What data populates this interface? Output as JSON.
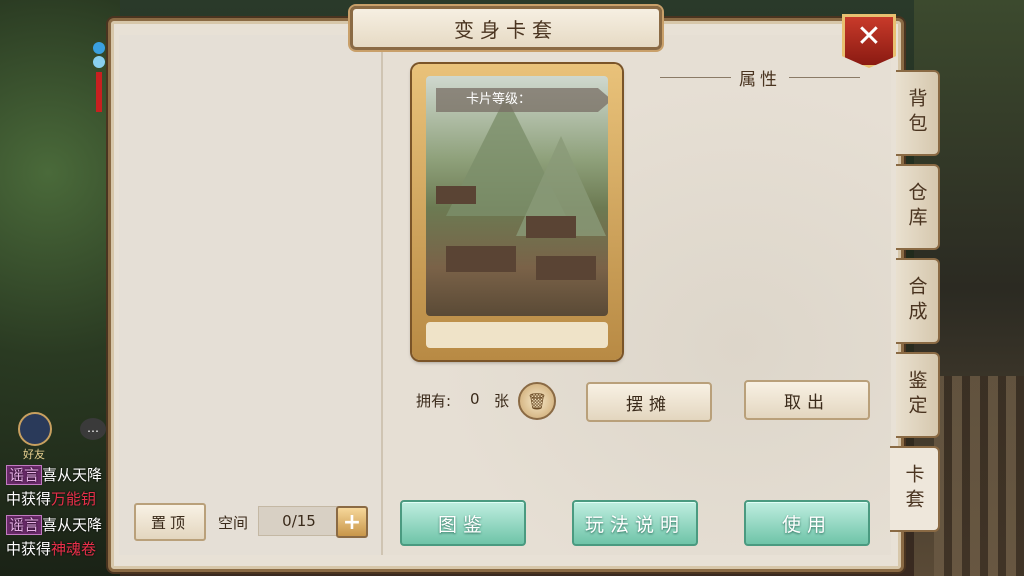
{
  "window": {
    "title": "变身卡套",
    "close_icon": "close-icon"
  },
  "side_tabs": [
    {
      "label": "背包",
      "active": false
    },
    {
      "label": "仓库",
      "active": false
    },
    {
      "label": "合成",
      "active": false
    },
    {
      "label": "鉴定",
      "active": false
    },
    {
      "label": "卡套",
      "active": true
    }
  ],
  "card": {
    "level_label": "卡片等级："
  },
  "attributes": {
    "heading": "属性"
  },
  "owned": {
    "label": "拥有:",
    "count": "0",
    "unit": "张"
  },
  "actions": {
    "stall": "摆摊",
    "take_out": "取出"
  },
  "bottom_buttons": {
    "codex": "图鉴",
    "guide": "玩法说明",
    "use": "使用"
  },
  "left_pane": {
    "pin_top": "置顶",
    "space_label": "空间",
    "space_value": "0/15"
  },
  "chat": {
    "friend_label": "好友",
    "lines": [
      {
        "tag": "谣言",
        "text": "喜从天降"
      },
      {
        "text": "中获得",
        "item": "万能钥"
      },
      {
        "tag": "谣言",
        "text": "喜从天降"
      },
      {
        "text": "中获得",
        "item": "神魂卷"
      }
    ]
  }
}
